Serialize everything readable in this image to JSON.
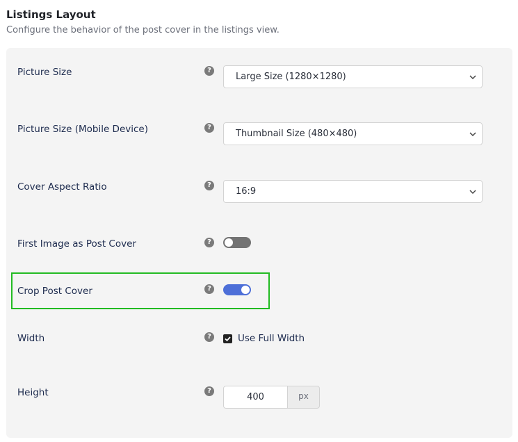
{
  "header": {
    "title": "Listings Layout",
    "subtitle": "Configure the behavior of the post cover in the listings view."
  },
  "icons": {
    "help": "?",
    "chevron": "chevron-down-icon",
    "check": "checkmark-icon"
  },
  "settings": {
    "picture_size": {
      "label": "Picture Size",
      "value": "Large Size (1280×1280)"
    },
    "picture_size_mobile": {
      "label": "Picture Size (Mobile Device)",
      "value": "Thumbnail Size (480×480)"
    },
    "cover_aspect_ratio": {
      "label": "Cover Aspect Ratio",
      "value": "16:9"
    },
    "first_image_as_cover": {
      "label": "First Image as Post Cover",
      "enabled": false
    },
    "crop_post_cover": {
      "label": "Crop Post Cover",
      "enabled": true
    },
    "width": {
      "label": "Width",
      "checkbox_label": "Use Full Width",
      "checked": true
    },
    "height": {
      "label": "Height",
      "value": "400",
      "unit": "px"
    }
  },
  "colors": {
    "toggle_on": "#4d6fd8",
    "toggle_off": "#737373",
    "highlight": "#22bb22"
  }
}
